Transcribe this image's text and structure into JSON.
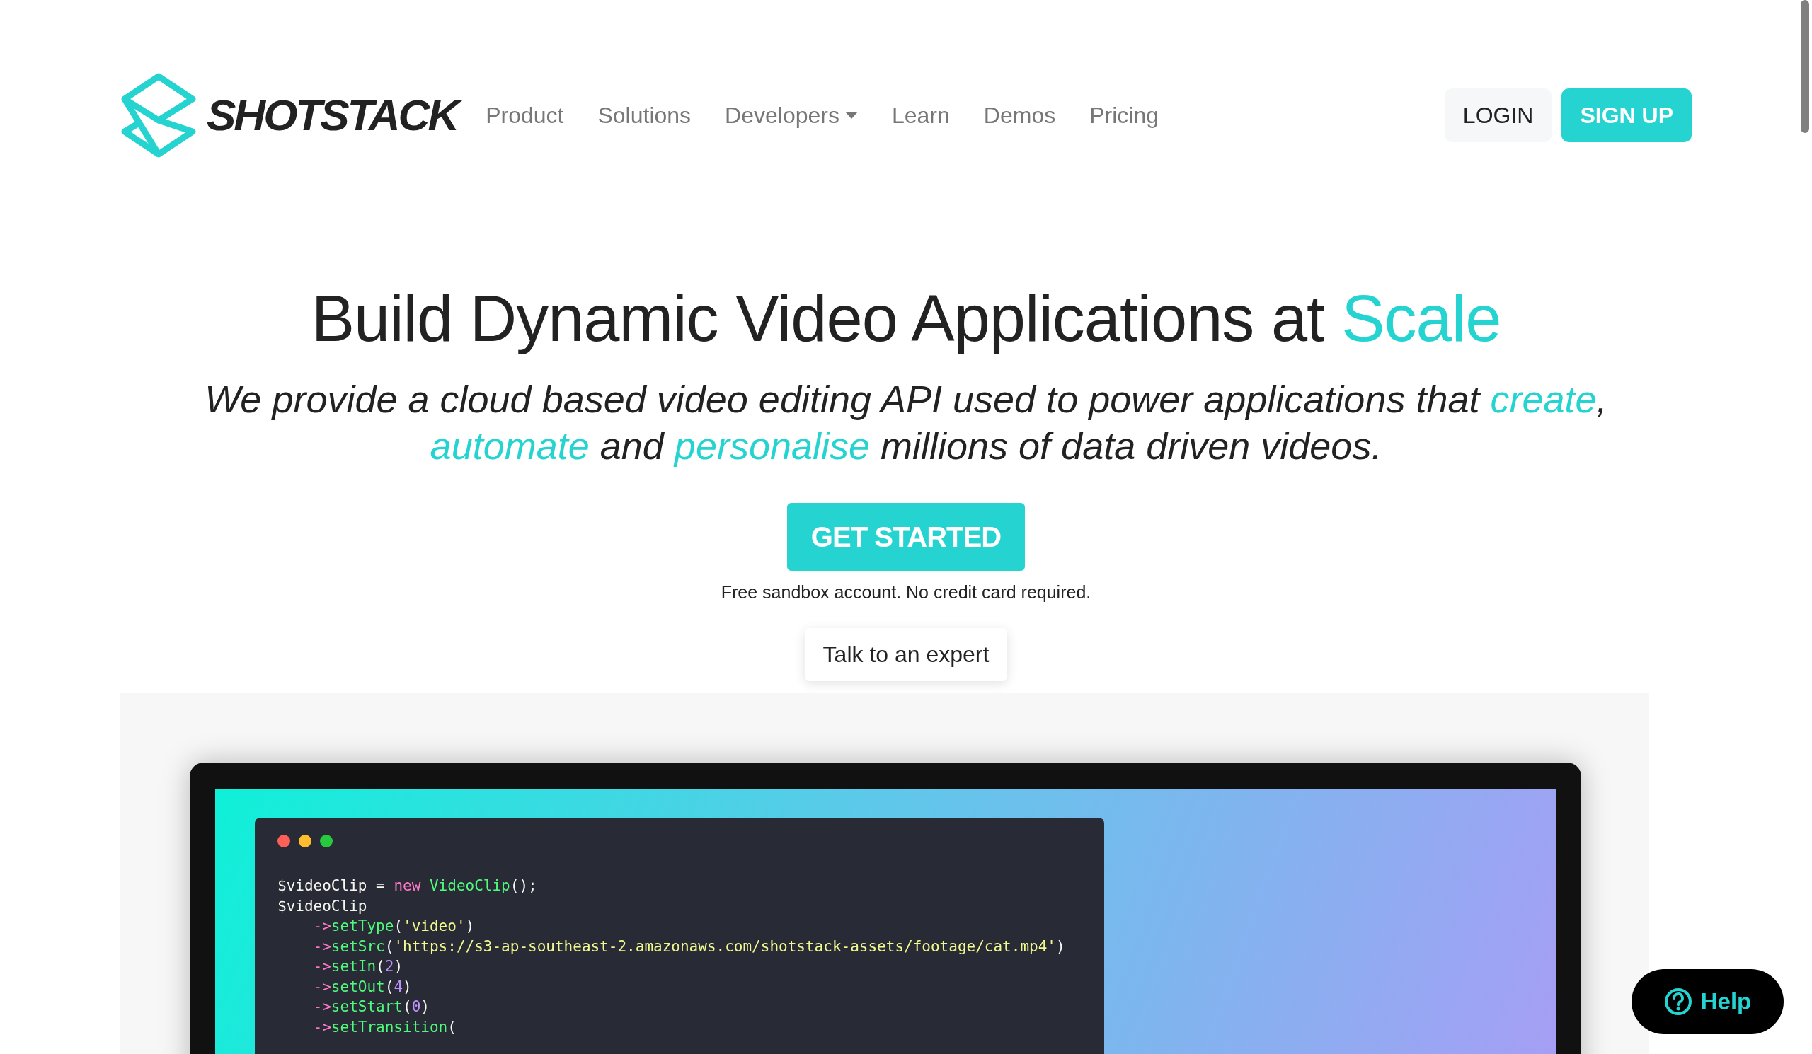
{
  "header": {
    "logo_text": "SHOTSTACK",
    "nav": [
      {
        "label": "Product",
        "dropdown": false
      },
      {
        "label": "Solutions",
        "dropdown": false
      },
      {
        "label": "Developers",
        "dropdown": true
      },
      {
        "label": "Learn",
        "dropdown": false
      },
      {
        "label": "Demos",
        "dropdown": false
      },
      {
        "label": "Pricing",
        "dropdown": false
      }
    ],
    "login": "LOGIN",
    "signup": "SIGN UP"
  },
  "hero": {
    "heading": [
      {
        "text": "Build Dynamic Video Applications at ",
        "accent": false
      },
      {
        "text": "Scale",
        "accent": true
      }
    ],
    "subtitle": [
      {
        "text": "We provide a cloud based video editing API used to power applications that ",
        "accent": false
      },
      {
        "text": "create",
        "accent": true
      },
      {
        "text": ", ",
        "accent": false
      },
      {
        "text": "automate",
        "accent": true
      },
      {
        "text": " and ",
        "accent": false
      },
      {
        "text": "personalise",
        "accent": true
      },
      {
        "text": " millions of data driven videos.",
        "accent": false
      }
    ],
    "cta": "GET STARTED",
    "note": "Free sandbox account. No credit card required.",
    "expert": "Talk to an expert"
  },
  "code_window": {
    "dots": [
      {
        "color": "#ff5f56"
      },
      {
        "color": "#ffbd2e"
      },
      {
        "color": "#27c93f"
      }
    ],
    "lines": [
      [
        {
          "t": "$videoClip = ",
          "kind": "plain"
        },
        {
          "t": "new",
          "kind": "keyword"
        },
        {
          "t": " VideoClip",
          "kind": "func"
        },
        {
          "t": "();",
          "kind": "plain"
        }
      ],
      [
        {
          "t": "$videoClip",
          "kind": "plain"
        }
      ],
      [
        {
          "t": "    ->",
          "kind": "keyword"
        },
        {
          "t": "setType",
          "kind": "func"
        },
        {
          "t": "(",
          "kind": "plain"
        },
        {
          "t": "'video'",
          "kind": "string"
        },
        {
          "t": ")",
          "kind": "plain"
        }
      ],
      [
        {
          "t": "    ->",
          "kind": "keyword"
        },
        {
          "t": "setSrc",
          "kind": "func"
        },
        {
          "t": "(",
          "kind": "plain"
        },
        {
          "t": "'https://s3-ap-southeast-2.amazonaws.com/shotstack-assets/footage/cat.mp4'",
          "kind": "string"
        },
        {
          "t": ")",
          "kind": "plain"
        }
      ],
      [
        {
          "t": "    ->",
          "kind": "keyword"
        },
        {
          "t": "setIn",
          "kind": "func"
        },
        {
          "t": "(",
          "kind": "plain"
        },
        {
          "t": "2",
          "kind": "number"
        },
        {
          "t": ")",
          "kind": "plain"
        }
      ],
      [
        {
          "t": "    ->",
          "kind": "keyword"
        },
        {
          "t": "setOut",
          "kind": "func"
        },
        {
          "t": "(",
          "kind": "plain"
        },
        {
          "t": "4",
          "kind": "number"
        },
        {
          "t": ")",
          "kind": "plain"
        }
      ],
      [
        {
          "t": "    ->",
          "kind": "keyword"
        },
        {
          "t": "setStart",
          "kind": "func"
        },
        {
          "t": "(",
          "kind": "plain"
        },
        {
          "t": "0",
          "kind": "number"
        },
        {
          "t": ")",
          "kind": "plain"
        }
      ],
      [
        {
          "t": "    ->",
          "kind": "keyword"
        },
        {
          "t": "setTransition",
          "kind": "func"
        },
        {
          "t": "(",
          "kind": "plain"
        }
      ]
    ]
  },
  "help": "Help"
}
